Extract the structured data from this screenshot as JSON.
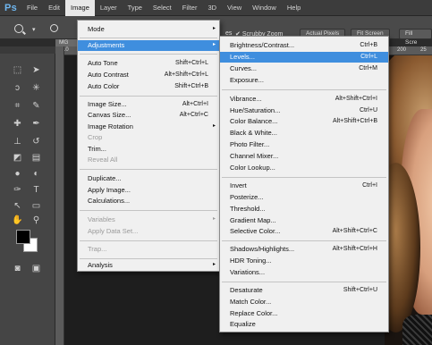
{
  "app": {
    "logo": "Ps"
  },
  "menubar": {
    "items": [
      "File",
      "Edit",
      "Image",
      "Layer",
      "Type",
      "Select",
      "Filter",
      "3D",
      "View",
      "Window",
      "Help"
    ]
  },
  "options": {
    "scrubby": "Scrubby Zoom",
    "actual_pixels": "Actual Pixels",
    "fit_screen": "Fit Screen",
    "fill_screen": "Fill Scre",
    "partial_es": "es",
    "mini_mg": "MG",
    "ruler_10": "10",
    "ruler_200": "200",
    "ruler_25": "25"
  },
  "image_menu": {
    "items": [
      {
        "label": "Mode",
        "arrow": "▸"
      },
      {
        "label": "Adjustments",
        "arrow": "▸"
      },
      {
        "label": "Auto Tone",
        "shortcut": "Shift+Ctrl+L"
      },
      {
        "label": "Auto Contrast",
        "shortcut": "Alt+Shift+Ctrl+L"
      },
      {
        "label": "Auto Color",
        "shortcut": "Shift+Ctrl+B"
      },
      {
        "label": "Image Size...",
        "shortcut": "Alt+Ctrl+I"
      },
      {
        "label": "Canvas Size...",
        "shortcut": "Alt+Ctrl+C"
      },
      {
        "label": "Image Rotation",
        "arrow": "▸"
      },
      {
        "label": "Crop"
      },
      {
        "label": "Trim..."
      },
      {
        "label": "Reveal All"
      },
      {
        "label": "Duplicate..."
      },
      {
        "label": "Apply Image..."
      },
      {
        "label": "Calculations..."
      },
      {
        "label": "Variables",
        "arrow": "▸"
      },
      {
        "label": "Apply Data Set..."
      },
      {
        "label": "Trap..."
      },
      {
        "label": "Analysis",
        "arrow": "▸"
      }
    ]
  },
  "adjust_menu": {
    "items": [
      {
        "label": "Brightness/Contrast...",
        "shortcut": "Ctrl+B"
      },
      {
        "label": "Levels...",
        "shortcut": "Ctrl+L"
      },
      {
        "label": "Curves...",
        "shortcut": "Ctrl+M"
      },
      {
        "label": "Exposure..."
      },
      {
        "label": "Vibrance...",
        "shortcut": "Alt+Shift+Ctrl+I"
      },
      {
        "label": "Hue/Saturation...",
        "shortcut": "Ctrl+U"
      },
      {
        "label": "Color Balance...",
        "shortcut": "Alt+Shift+Ctrl+B"
      },
      {
        "label": "Black & White..."
      },
      {
        "label": "Photo Filter..."
      },
      {
        "label": "Channel Mixer..."
      },
      {
        "label": "Color Lookup..."
      },
      {
        "label": "Invert",
        "shortcut": "Ctrl+I"
      },
      {
        "label": "Posterize..."
      },
      {
        "label": "Threshold..."
      },
      {
        "label": "Gradient Map..."
      },
      {
        "label": "Selective Color...",
        "shortcut": "Alt+Shift+Ctrl+C"
      },
      {
        "label": "Shadows/Highlights...",
        "shortcut": "Alt+Shift+Ctrl+H"
      },
      {
        "label": "HDR Toning..."
      },
      {
        "label": "Variations..."
      },
      {
        "label": "Desaturate",
        "shortcut": "Shift+Ctrl+U"
      },
      {
        "label": "Match Color..."
      },
      {
        "label": "Replace Color..."
      },
      {
        "label": "Equalize"
      }
    ]
  },
  "colors": {
    "highlight": "#3f8ede",
    "menu_bg": "#f0f0f0",
    "logo": "#6fb7f0"
  }
}
